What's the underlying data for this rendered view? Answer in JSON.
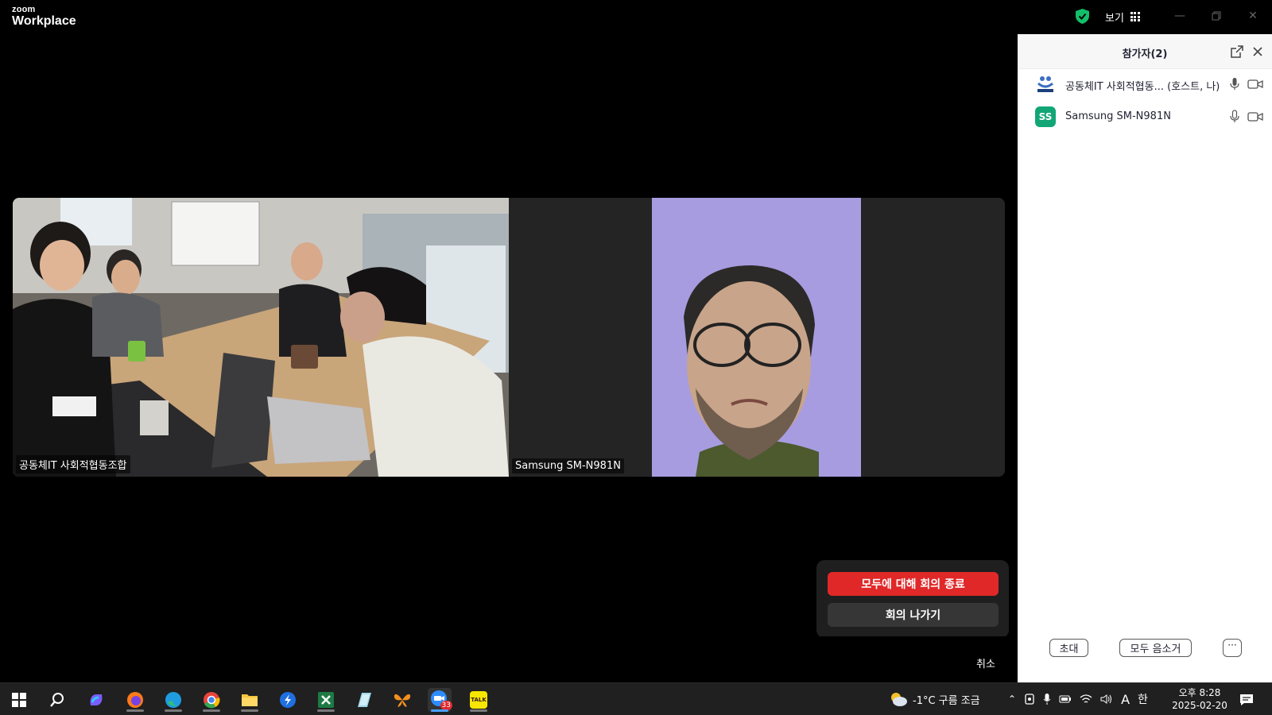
{
  "titlebar": {
    "brand_line1": "zoom",
    "brand_line2": "Workplace",
    "view_label": "보기"
  },
  "gallery": {
    "tiles": [
      {
        "name": "공동체IT 사회적협동조합"
      },
      {
        "name": "Samsung SM-N981N"
      }
    ]
  },
  "leave_popover": {
    "end_for_all_label": "모두에 대해 회의 종료",
    "leave_label": "회의 나가기"
  },
  "toolbar": {
    "cancel_label": "취소"
  },
  "participants_panel": {
    "title": "참가자(2)",
    "participants": [
      {
        "name": "공동체IT 사회적협동... (호스트, 나)",
        "avatar": "logo"
      },
      {
        "name": "Samsung SM-N981N",
        "avatar_initials": "SS"
      }
    ],
    "footer": {
      "invite_label": "초대",
      "mute_all_label": "모두 음소거",
      "more_label": "···"
    }
  },
  "taskbar": {
    "apps": [
      "start-icon",
      "search-icon",
      "copilot-icon",
      "firefox-icon",
      "edge-icon",
      "chrome-icon",
      "file-explorer-icon",
      "app-blue-icon",
      "excel-icon",
      "notes-icon",
      "butterfly-icon",
      "zoom-icon",
      "kakaotalk-icon"
    ],
    "zoom_badge": "33",
    "kakao_label": "TALK",
    "weather": "-1°C  구름 조금",
    "ime_label": "A",
    "ime_hangul": "한",
    "time": "오후 8:28",
    "date": "2025-02-20"
  },
  "colors": {
    "end_button": "#e02828",
    "ss_avatar": "#12a676",
    "video_bg": "#a79ce0",
    "shield": "#12c06a"
  }
}
